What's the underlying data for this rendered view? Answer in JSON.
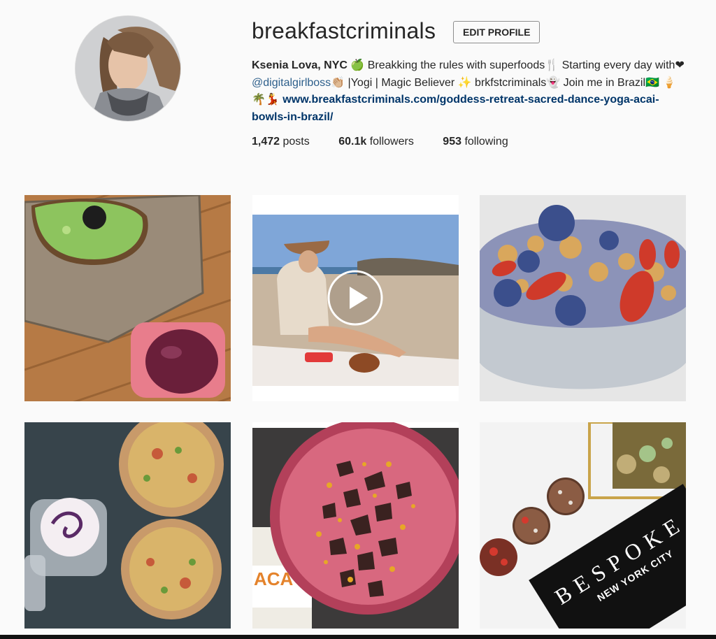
{
  "profile": {
    "username": "breakfastcriminals",
    "edit_button_label": "EDIT PROFILE",
    "full_name": "Ksenia Lova, NYC",
    "bio": {
      "part1": " 🍏 Breakking the rules with superfoods🍴 Starting every day with❤ ",
      "mention": "@digitalgirlboss",
      "part2": "👏🏼 |Yogi | Magic Believer ✨ brkfstcriminals👻 Join me in Brazil🇧🇷 🍦🌴💃 ",
      "link": "www.breakfastcriminals.com/goddess-retreat-sacred-dance-yoga-acai-bowls-in-brazil/"
    },
    "stats": {
      "posts_count": "1,472",
      "posts_label": "posts",
      "followers_count": "60.1k",
      "followers_label": "followers",
      "following_count": "953",
      "following_label": "following"
    }
  },
  "posts": [
    {
      "subject": "avocado toast with green smoothie on wooden board",
      "is_video": false
    },
    {
      "subject": "woman in hat sitting on beach blanket",
      "is_video": true
    },
    {
      "subject": "smoothie bowl with blueberries, goji berries and granola",
      "is_video": false
    },
    {
      "subject": "grain bowls and berry yogurt jar",
      "is_video": false
    },
    {
      "subject": "pink acai smoothie bowl with cacao nibs and bee pollen",
      "is_video": false
    },
    {
      "subject": "energy balls and Bespoke New York City box",
      "is_video": false
    }
  ],
  "bespoke_box": {
    "brand": "BESPOKE",
    "city": "NEW YORK CITY"
  },
  "acai_jar_label": "ACA",
  "icons": {
    "play": "play-icon"
  }
}
